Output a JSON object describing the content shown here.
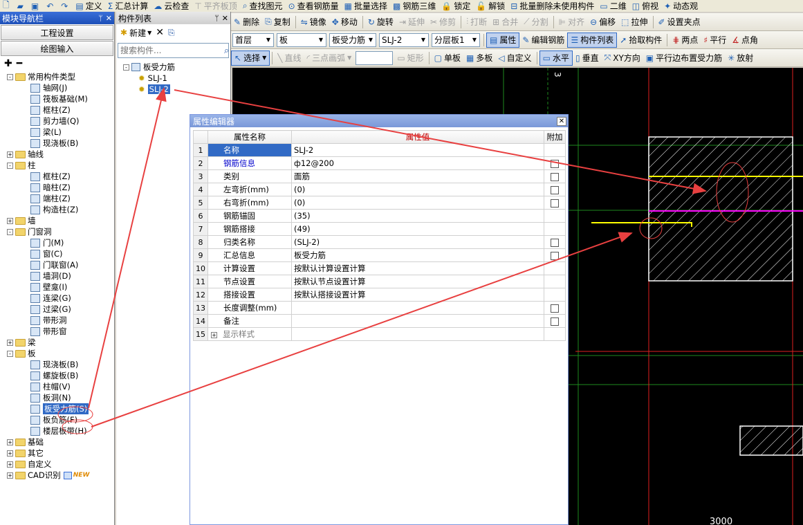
{
  "top_strip": [
    {
      "icon": "new-file-icon",
      "label": ""
    },
    {
      "icon": "open-folder-icon",
      "label": ""
    },
    {
      "icon": "save-icon",
      "label": ""
    },
    {
      "icon": "undo-icon",
      "label": ""
    },
    {
      "icon": "redo-icon",
      "label": ""
    },
    {
      "icon": "define-icon",
      "label": "定义"
    },
    {
      "icon": "sum-icon",
      "label": "汇总计算"
    },
    {
      "icon": "cloud-check-icon",
      "label": "云检查"
    },
    {
      "icon": "align-top-icon",
      "label": "平齐板顶",
      "disabled": true
    },
    {
      "icon": "find-element-icon",
      "label": "查找图元"
    },
    {
      "icon": "view-rebar-icon",
      "label": "查看钢筋量"
    },
    {
      "icon": "batch-select-icon",
      "label": "批量选择"
    },
    {
      "icon": "rebar-3d-icon",
      "label": "钢筋三维"
    },
    {
      "icon": "lock-icon",
      "label": "锁定"
    },
    {
      "icon": "unlock-icon",
      "label": "解锁"
    },
    {
      "icon": "batch-delete-icon",
      "label": "批量删除未使用构件"
    },
    {
      "icon": "2d-icon",
      "label": "二维"
    },
    {
      "icon": "top-view-icon",
      "label": "俯视"
    },
    {
      "icon": "dynamic-view-icon",
      "label": "动态观"
    }
  ],
  "left_nav": {
    "title": "模块导航栏",
    "btn_project": "工程设置",
    "btn_draw": "绘图输入",
    "tree": [
      {
        "level": 0,
        "pm": "-",
        "folder": true,
        "label": "常用构件类型"
      },
      {
        "level": 1,
        "label": "轴网(J)",
        "icon": "grid-icon"
      },
      {
        "level": 1,
        "label": "筏板基础(M)",
        "icon": "raft-foundation-icon"
      },
      {
        "level": 1,
        "label": "框柱(Z)",
        "icon": "frame-column-icon"
      },
      {
        "level": 1,
        "label": "剪力墙(Q)",
        "icon": "shear-wall-icon"
      },
      {
        "level": 1,
        "label": "梁(L)",
        "icon": "beam-icon"
      },
      {
        "level": 1,
        "label": "现浇板(B)",
        "icon": "slab-icon"
      },
      {
        "level": 0,
        "pm": "+",
        "folder": true,
        "label": "轴线"
      },
      {
        "level": 0,
        "pm": "-",
        "folder": true,
        "label": "柱"
      },
      {
        "level": 1,
        "label": "框柱(Z)",
        "icon": "frame-column-icon"
      },
      {
        "level": 1,
        "label": "暗柱(Z)",
        "icon": "hidden-column-icon"
      },
      {
        "level": 1,
        "label": "端柱(Z)",
        "icon": "end-column-icon"
      },
      {
        "level": 1,
        "label": "构造柱(Z)",
        "icon": "construction-column-icon"
      },
      {
        "level": 0,
        "pm": "+",
        "folder": true,
        "label": "墙"
      },
      {
        "level": 0,
        "pm": "-",
        "folder": true,
        "label": "门窗洞"
      },
      {
        "level": 1,
        "label": "门(M)",
        "icon": "door-icon"
      },
      {
        "level": 1,
        "label": "窗(C)",
        "icon": "window-icon"
      },
      {
        "level": 1,
        "label": "门联窗(A)",
        "icon": "door-window-icon"
      },
      {
        "level": 1,
        "label": "墙洞(D)",
        "icon": "wall-opening-icon"
      },
      {
        "level": 1,
        "label": "壁龛(I)",
        "icon": "niche-icon"
      },
      {
        "level": 1,
        "label": "连梁(G)",
        "icon": "coupling-beam-icon"
      },
      {
        "level": 1,
        "label": "过梁(G)",
        "icon": "lintel-icon"
      },
      {
        "level": 1,
        "label": "带形洞",
        "icon": "strip-opening-icon"
      },
      {
        "level": 1,
        "label": "带形窗",
        "icon": "strip-window-icon"
      },
      {
        "level": 0,
        "pm": "+",
        "folder": true,
        "label": "梁"
      },
      {
        "level": 0,
        "pm": "-",
        "folder": true,
        "label": "板"
      },
      {
        "level": 1,
        "label": "现浇板(B)",
        "icon": "slab-icon"
      },
      {
        "level": 1,
        "label": "螺旋板(B)",
        "icon": "spiral-slab-icon"
      },
      {
        "level": 1,
        "label": "柱帽(V)",
        "icon": "column-cap-icon"
      },
      {
        "level": 1,
        "label": "板洞(N)",
        "icon": "slab-opening-icon"
      },
      {
        "level": 1,
        "label": "板受力筋(S)",
        "icon": "slab-rebar-icon",
        "selected": true
      },
      {
        "level": 1,
        "label": "板负筋(F)",
        "icon": "negative-rebar-icon"
      },
      {
        "level": 1,
        "label": "楼层板带(H)",
        "icon": "slab-strip-icon"
      },
      {
        "level": 0,
        "pm": "+",
        "folder": true,
        "label": "基础"
      },
      {
        "level": 0,
        "pm": "+",
        "folder": true,
        "label": "其它"
      },
      {
        "level": 0,
        "pm": "+",
        "folder": true,
        "label": "自定义"
      },
      {
        "level": 0,
        "pm": "+",
        "folder": true,
        "label": "CAD识别",
        "badge": "NEW"
      }
    ]
  },
  "comp_list": {
    "title": "构件列表",
    "new_label": "新建",
    "search_placeholder": "搜索构件...",
    "root": "板受力筋",
    "items": [
      "SLJ-1",
      "SLJ-2"
    ],
    "selected": "SLJ-2"
  },
  "toolbar1": [
    {
      "label": "删除",
      "icon": "delete-icon",
      "g": "✎"
    },
    {
      "label": "复制",
      "icon": "copy-icon",
      "g": "⎘"
    },
    {
      "label": "镜像",
      "icon": "mirror-icon",
      "g": "⇋"
    },
    {
      "label": "移动",
      "icon": "move-icon",
      "g": "✥"
    },
    {
      "label": "旋转",
      "icon": "rotate-icon",
      "g": "↻"
    },
    {
      "label": "延伸",
      "icon": "extend-icon",
      "g": "⇥",
      "disabled": true
    },
    {
      "label": "修剪",
      "icon": "trim-icon",
      "g": "✂",
      "disabled": true
    },
    {
      "label": "打断",
      "icon": "break-icon",
      "g": "⫶",
      "disabled": true
    },
    {
      "label": "合并",
      "icon": "merge-icon",
      "g": "⊞",
      "disabled": true
    },
    {
      "label": "分割",
      "icon": "split-icon",
      "g": "⟋",
      "disabled": true
    },
    {
      "label": "对齐",
      "icon": "align-icon",
      "g": "⊫",
      "disabled": true
    },
    {
      "label": "偏移",
      "icon": "offset-icon",
      "g": "⊖"
    },
    {
      "label": "拉伸",
      "icon": "stretch-icon",
      "g": "⬚"
    },
    {
      "label": "设置夹点",
      "icon": "set-grip-icon",
      "g": "✐"
    }
  ],
  "toolbar2": {
    "floor": "首层",
    "category": "板",
    "type": "板受力筋",
    "component": "SLJ-2",
    "layer": "分层板1",
    "buttons": [
      {
        "label": "属性",
        "icon": "property-icon",
        "pressed": true
      },
      {
        "label": "编辑钢筋",
        "icon": "edit-rebar-icon"
      },
      {
        "label": "构件列表",
        "icon": "component-list-icon",
        "pressed": true
      },
      {
        "label": "拾取构件",
        "icon": "pick-component-icon"
      },
      {
        "label": "两点",
        "icon": "two-points-icon"
      },
      {
        "label": "平行",
        "icon": "parallel-icon"
      },
      {
        "label": "点角",
        "icon": "point-angle-icon"
      }
    ]
  },
  "toolbar3": [
    {
      "label": "选择",
      "icon": "select-icon",
      "pressed": true
    },
    {
      "label": "直线",
      "icon": "line-icon",
      "disabled": true
    },
    {
      "label": "三点画弧",
      "icon": "arc-icon",
      "disabled": true
    },
    {
      "label": "矩形",
      "icon": "rectangle-icon",
      "disabled": true
    },
    {
      "label": "单板",
      "icon": "single-slab-icon"
    },
    {
      "label": "多板",
      "icon": "multi-slab-icon"
    },
    {
      "label": "自定义",
      "icon": "custom-icon"
    },
    {
      "label": "水平",
      "icon": "horizontal-icon",
      "pressed": true
    },
    {
      "label": "垂直",
      "icon": "vertical-icon"
    },
    {
      "label": "XY方向",
      "icon": "xy-direction-icon"
    },
    {
      "label": "平行边布置受力筋",
      "icon": "parallel-edge-icon"
    },
    {
      "label": "放射",
      "icon": "radial-icon"
    }
  ],
  "prop_editor": {
    "title": "属性编辑器",
    "col_name": "属性名称",
    "col_value": "属性值",
    "col_extra": "附加",
    "rows": [
      {
        "n": "1",
        "k": "名称",
        "v": "SLJ-2",
        "cb": false,
        "selected": true
      },
      {
        "n": "2",
        "k": "钢筋信息",
        "v": "ф12@200",
        "cb": true,
        "blue": true
      },
      {
        "n": "3",
        "k": "类别",
        "v": "面筋",
        "cb": true
      },
      {
        "n": "4",
        "k": "左弯折(mm)",
        "v": "(0)",
        "cb": true
      },
      {
        "n": "5",
        "k": "右弯折(mm)",
        "v": "(0)",
        "cb": true
      },
      {
        "n": "6",
        "k": "钢筋锚固",
        "v": "(35)",
        "cb": false
      },
      {
        "n": "7",
        "k": "钢筋搭接",
        "v": "(49)",
        "cb": false
      },
      {
        "n": "8",
        "k": "归类名称",
        "v": "(SLJ-2)",
        "cb": true
      },
      {
        "n": "9",
        "k": "汇总信息",
        "v": "板受力筋",
        "cb": true
      },
      {
        "n": "10",
        "k": "计算设置",
        "v": "按默认计算设置计算",
        "cb": false
      },
      {
        "n": "11",
        "k": "节点设置",
        "v": "按默认节点设置计算",
        "cb": false
      },
      {
        "n": "12",
        "k": "搭接设置",
        "v": "按默认搭接设置计算",
        "cb": false
      },
      {
        "n": "13",
        "k": "长度调整(mm)",
        "v": "",
        "cb": true
      },
      {
        "n": "14",
        "k": "备注",
        "v": "",
        "cb": true
      },
      {
        "n": "15",
        "k": "显示样式",
        "v": "",
        "cb": false,
        "expand": true
      }
    ]
  },
  "canvas": {
    "dim_bottom": "3000",
    "dim_top": "3"
  },
  "colors": {
    "canvas_bg": "#000000",
    "grid_green": "#1e8a1e",
    "axis_red": "#e02020",
    "rebar_yellow": "#ffff00",
    "rebar_magenta": "#ff00ff",
    "annotation_red": "#e84040"
  }
}
